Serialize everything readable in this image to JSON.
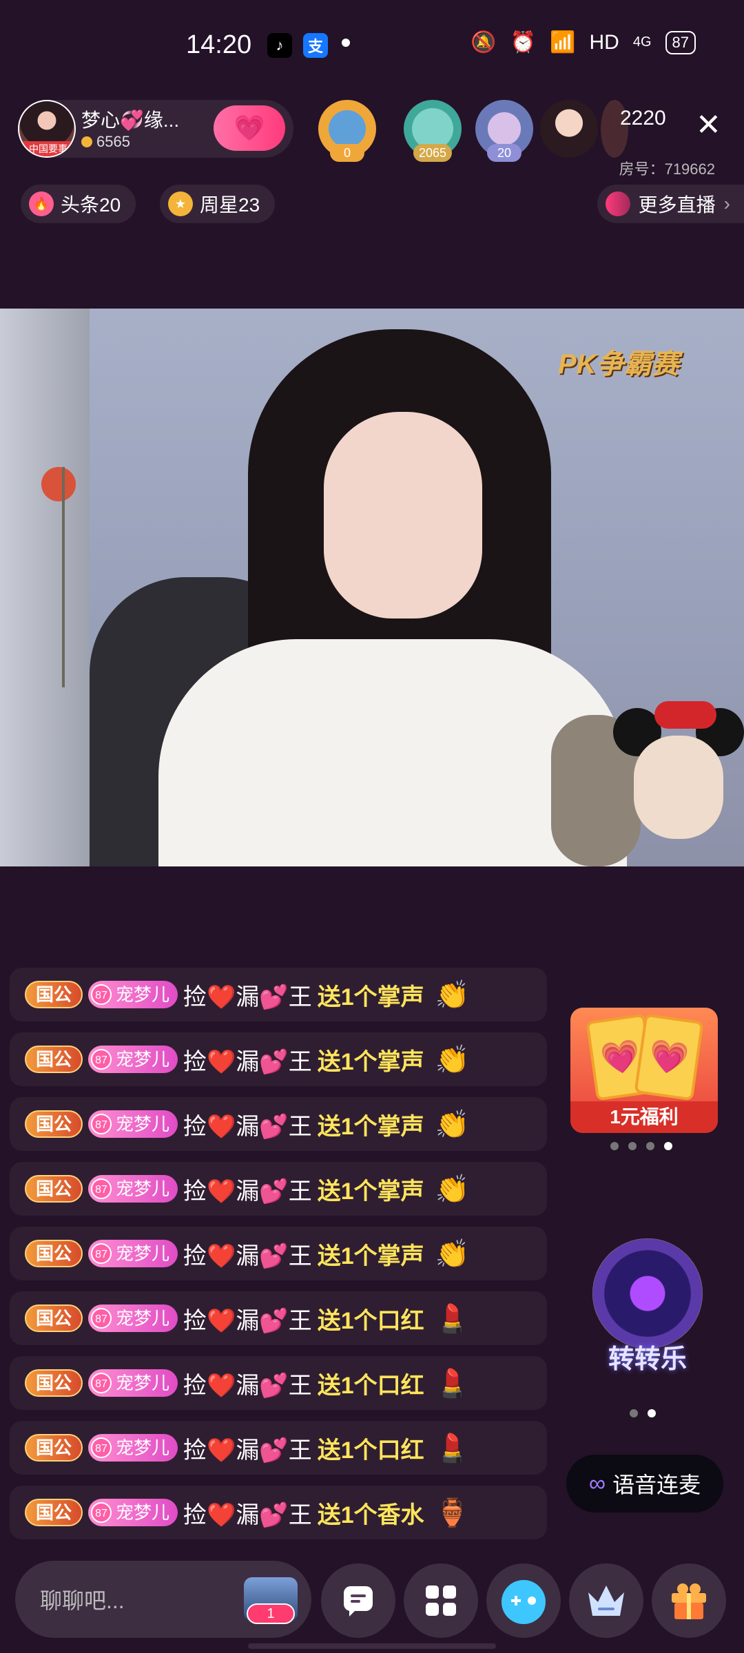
{
  "status_bar": {
    "time": "14:20",
    "network": "HD",
    "signal": "4G",
    "battery": "87"
  },
  "host": {
    "name": "梦心💞缘...",
    "likes": "6565",
    "tag": "中国要事"
  },
  "viewers": [
    {
      "badge": "0",
      "badge_color": "#f0a73a"
    },
    {
      "badge": "2065",
      "badge_color": "#d4a848"
    },
    {
      "badge": "20",
      "badge_color": "#8f8fd8"
    }
  ],
  "viewer_count": "2220",
  "room_number": "房号：719662",
  "chips": {
    "headline": "头条20",
    "weekly_star": "周星23",
    "more_live": "更多直播"
  },
  "video": {
    "pk_logo": "PK争霸赛"
  },
  "chat": {
    "badge_rank": "国公",
    "badge_fan_level": "87",
    "badge_fan_name": "宠梦儿",
    "messages": [
      {
        "user": "捡❤️漏💕王",
        "text": "送1个掌声",
        "gift": "👏"
      },
      {
        "user": "捡❤️漏💕王",
        "text": "送1个掌声",
        "gift": "👏"
      },
      {
        "user": "捡❤️漏💕王",
        "text": "送1个掌声",
        "gift": "👏"
      },
      {
        "user": "捡❤️漏💕王",
        "text": "送1个掌声",
        "gift": "👏"
      },
      {
        "user": "捡❤️漏💕王",
        "text": "送1个掌声",
        "gift": "👏"
      },
      {
        "user": "捡❤️漏💕王",
        "text": "送1个口红",
        "gift": "💄"
      },
      {
        "user": "捡❤️漏💕王",
        "text": "送1个口红",
        "gift": "💄"
      },
      {
        "user": "捡❤️漏💕王",
        "text": "送1个口红",
        "gift": "💄"
      },
      {
        "user": "捡❤️漏💕王",
        "text": "送1个香水",
        "gift": "🏺"
      }
    ]
  },
  "widgets": {
    "welfare_label": "1元福利",
    "spin_label": "转转乐",
    "voice_link": "语音连麦"
  },
  "bottom_bar": {
    "chat_placeholder": "聊聊吧...",
    "gift_count": "1",
    "icons": [
      "message-icon",
      "apps-icon",
      "game-icon",
      "crown-icon",
      "gift-icon"
    ]
  },
  "colors": {
    "background": "#241228",
    "accent_pink": "#ff3b7c",
    "chat_highlight": "#ffe55c"
  }
}
